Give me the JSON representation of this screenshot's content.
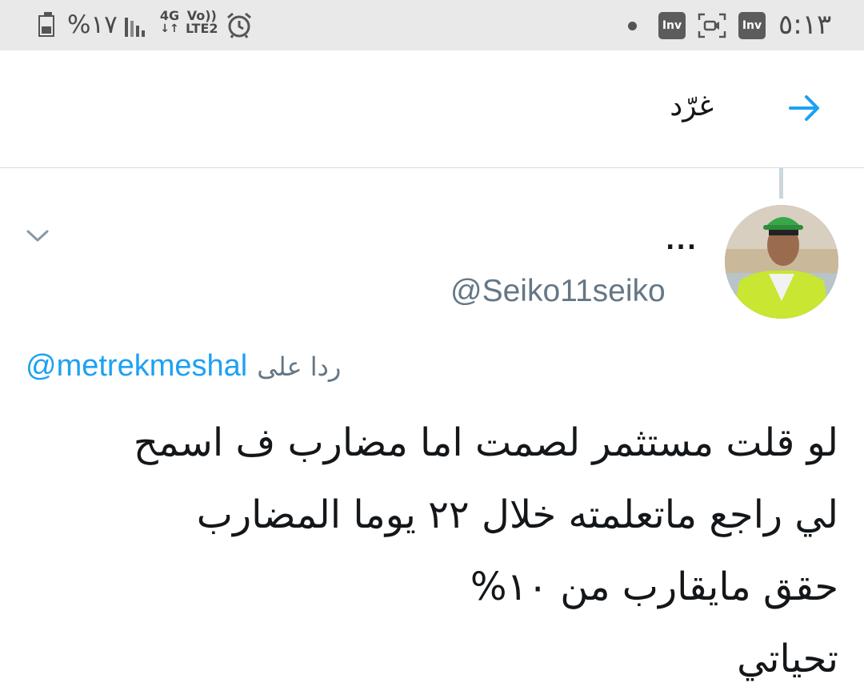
{
  "status_bar": {
    "battery_percent": "%١٧",
    "network": "4G",
    "volte_top": "Vo))",
    "volte_bottom": "LTE2",
    "app_badge_1": "Inv",
    "app_badge_2": "Inv",
    "time": "٥:١٣",
    "icons": [
      "battery-icon",
      "signal-icon",
      "alarm-icon",
      "notification-dot-icon",
      "app-badge-icon",
      "screen-record-icon",
      "app-badge-icon"
    ]
  },
  "header": {
    "title": "غرّد",
    "back_icon": "arrow-right-icon",
    "accent_color": "#1da1f2"
  },
  "tweet": {
    "display_name": "...",
    "handle": "@Seiko11seiko",
    "reply_prefix": "ردا على",
    "reply_to": "@metrekmeshal",
    "text_lines": [
      "لو قلت مستثمر لصمت اما مضارب ف اسمح",
      "لي راجع ماتعلمته خلال ٢٢ يوما المضارب",
      "حقق مايقارب من ١٠%",
      "تحياتي"
    ],
    "menu_icon": "chevron-down-icon"
  }
}
